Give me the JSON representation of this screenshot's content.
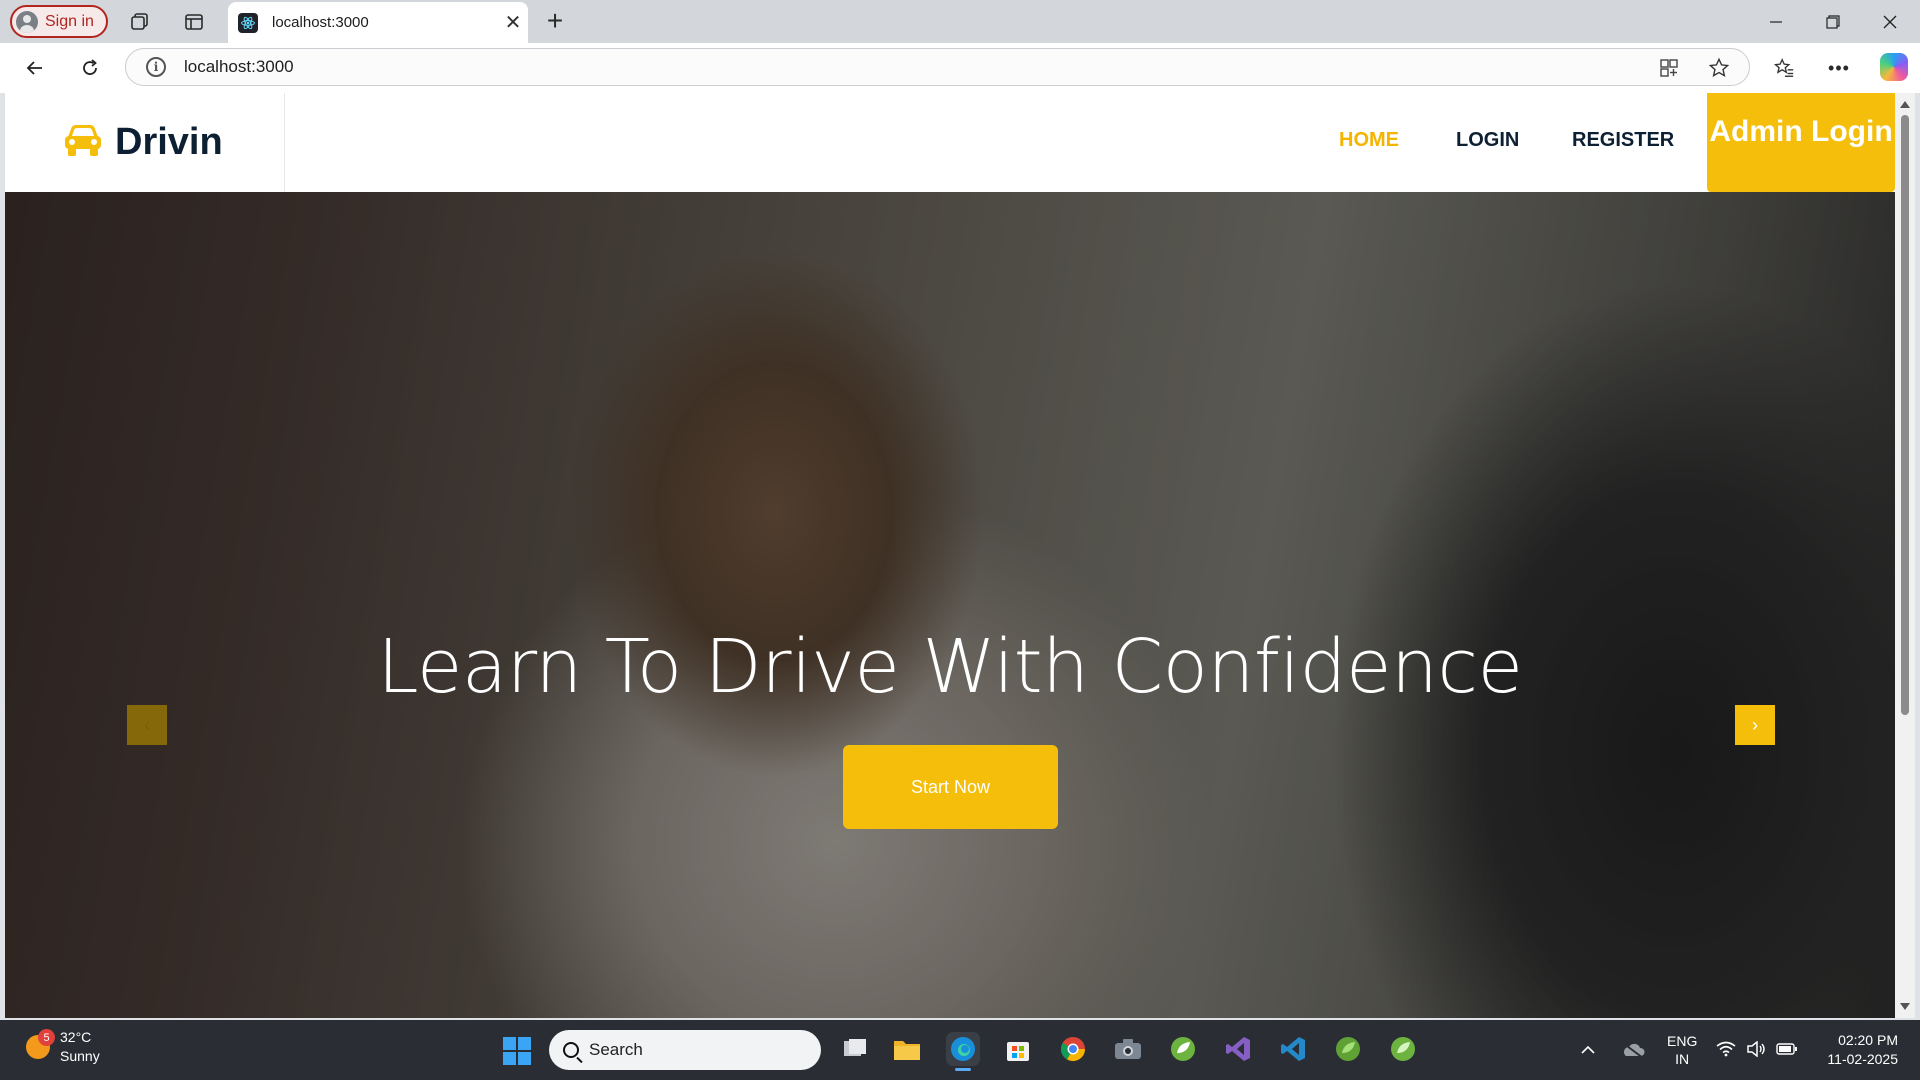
{
  "browser": {
    "signin_label": "Sign in",
    "tab_title": "localhost:3000",
    "tab_close": "✕",
    "new_tab": "+",
    "url": "localhost:3000"
  },
  "site": {
    "brand": "Drivin",
    "nav": [
      "HOME",
      "LOGIN",
      "REGISTER"
    ],
    "admin_login": "Admin Login",
    "accent_color": "#f5be0b",
    "hero": {
      "headline": "Learn To Drive With Confidence",
      "cta": "Start Now",
      "prev": "‹",
      "next": "›"
    }
  },
  "taskbar": {
    "weather_badge": "5",
    "temperature": "32°C",
    "condition": "Sunny",
    "search_label": "Search",
    "lang_line1": "ENG",
    "lang_line2": "IN",
    "time": "02:20 PM",
    "date": "11-02-2025"
  }
}
